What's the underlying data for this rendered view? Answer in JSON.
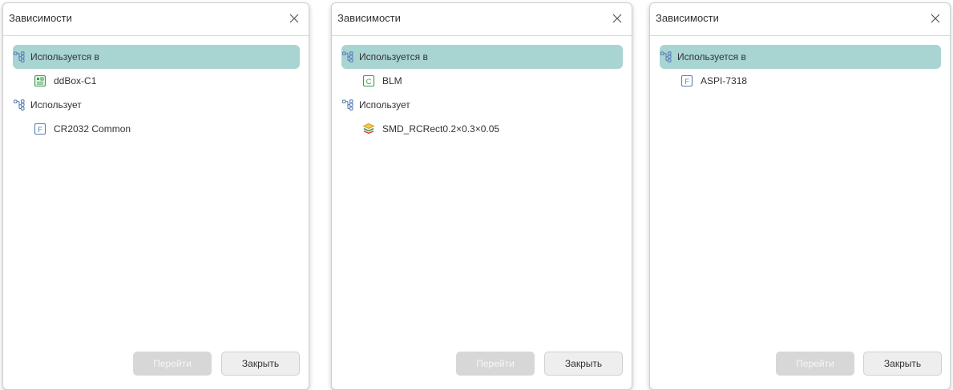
{
  "colors": {
    "selected_row": "#a8d4d2",
    "disabled_button": "#d7d7d7",
    "form_icon": "#5b7fb8",
    "component_icon": "#3a9a4e"
  },
  "dialogs": [
    {
      "title": "Зависимости",
      "tree": [
        {
          "kind": "group",
          "icon": "hierarchy-icon",
          "label": "Используется в",
          "selected": true
        },
        {
          "kind": "item",
          "icon": "board-icon",
          "label": "ddBox-C1"
        },
        {
          "kind": "group",
          "icon": "hierarchy-icon",
          "label": "Использует",
          "selected": false
        },
        {
          "kind": "item",
          "icon": "form-f-icon",
          "label": "CR2032 Common"
        }
      ],
      "buttons": {
        "go": "Перейти",
        "close": "Закрыть"
      }
    },
    {
      "title": "Зависимости",
      "tree": [
        {
          "kind": "group",
          "icon": "hierarchy-icon",
          "label": "Используется в",
          "selected": true
        },
        {
          "kind": "item",
          "icon": "component-c-icon",
          "label": "BLM"
        },
        {
          "kind": "group",
          "icon": "hierarchy-icon",
          "label": "Использует",
          "selected": false
        },
        {
          "kind": "item",
          "icon": "layers-icon",
          "label": "SMD_RCRect0.2×0.3×0.05"
        }
      ],
      "buttons": {
        "go": "Перейти",
        "close": "Закрыть"
      }
    },
    {
      "title": "Зависимости",
      "tree": [
        {
          "kind": "group",
          "icon": "hierarchy-icon",
          "label": "Используется в",
          "selected": true
        },
        {
          "kind": "item",
          "icon": "form-f-icon",
          "label": "ASPI-7318"
        }
      ],
      "buttons": {
        "go": "Перейти",
        "close": "Закрыть"
      }
    }
  ]
}
